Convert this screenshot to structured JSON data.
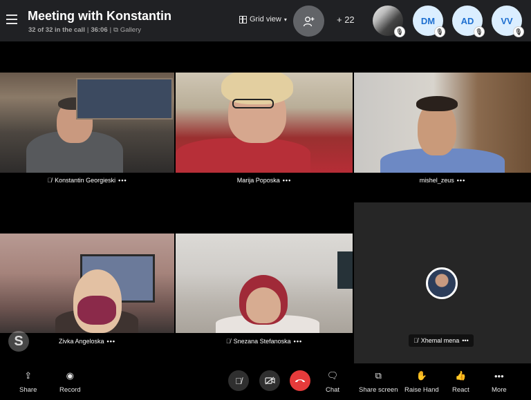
{
  "header": {
    "title": "Meeting with Konstantin",
    "call_info": "32 of 32 in the call",
    "duration": "36:06",
    "gallery_label": "Gallery",
    "grid_view_label": "Grid view",
    "extra_participants": "+ 22",
    "avatars": [
      {
        "initials": ""
      },
      {
        "initials": "DM"
      },
      {
        "initials": "AD"
      },
      {
        "initials": "VV"
      }
    ]
  },
  "participants": [
    {
      "name": "Konstantin Georgieski",
      "muted": true
    },
    {
      "name": "Marija Poposka",
      "muted": false
    },
    {
      "name": "mishel_zeus",
      "muted": false
    },
    {
      "name": "Zivka Angeloska",
      "muted": false
    },
    {
      "name": "Snezana Stefanoska",
      "muted": true
    },
    {
      "name": "Xhemal mena",
      "muted": true
    }
  ],
  "more_glyph": "•••",
  "toolbar": {
    "share": "Share",
    "record": "Record",
    "chat": "Chat",
    "share_screen": "Share screen",
    "raise_hand": "Raise Hand",
    "react": "React",
    "more": "More"
  },
  "colors": {
    "header_bg": "#202124",
    "avatar_bg": "#dbeeff",
    "avatar_text": "#1e6fd0",
    "hangup_red": "#e63b3b"
  }
}
